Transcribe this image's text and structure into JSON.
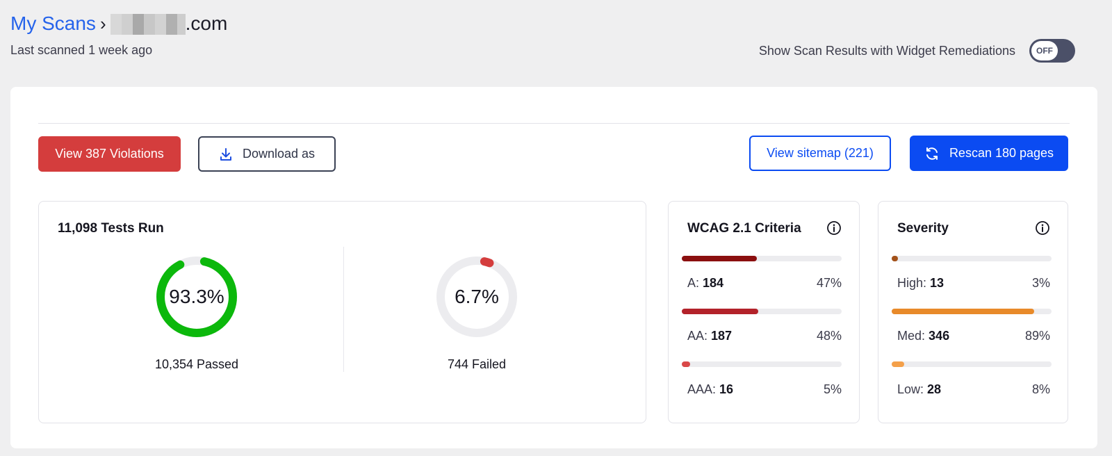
{
  "header": {
    "breadcrumb_root": "My Scans",
    "breadcrumb_separator": "›",
    "domain_suffix": ".com",
    "last_scanned": "Last scanned 1 week ago",
    "toggle_label": "Show Scan Results with Widget Remediations",
    "toggle_state": "OFF"
  },
  "actions": {
    "violations_label": "View 387 Violations",
    "download_label": "Download as",
    "sitemap_label": "View sitemap (221)",
    "rescan_label": "Rescan 180 pages"
  },
  "tests": {
    "title": "11,098 Tests Run",
    "passed_pct": 93.3,
    "passed_pct_label": "93.3%",
    "passed_caption": "10,354 Passed",
    "failed_pct": 6.7,
    "failed_pct_label": "6.7%",
    "failed_caption": "744 Failed",
    "passed_color": "#0cb80c",
    "failed_color": "#d43d3d",
    "track_color": "#ececef"
  },
  "wcag": {
    "title": "WCAG 2.1 Criteria",
    "rows": [
      {
        "label": "A:",
        "count": "184",
        "pct_label": "47%",
        "fraction": 0.47,
        "color": "#8b0f0f"
      },
      {
        "label": "AA:",
        "count": "187",
        "pct_label": "48%",
        "fraction": 0.48,
        "color": "#b3222a"
      },
      {
        "label": "AAA:",
        "count": "16",
        "pct_label": "5%",
        "fraction": 0.05,
        "color": "#d94848"
      }
    ]
  },
  "severity": {
    "title": "Severity",
    "rows": [
      {
        "label": "High:",
        "count": "13",
        "pct_label": "3%",
        "fraction": 0.03,
        "color": "#a3521a"
      },
      {
        "label": "Med:",
        "count": "346",
        "pct_label": "89%",
        "fraction": 0.89,
        "color": "#e88a2a"
      },
      {
        "label": "Low:",
        "count": "28",
        "pct_label": "8%",
        "fraction": 0.08,
        "color": "#f4a04a"
      }
    ]
  }
}
